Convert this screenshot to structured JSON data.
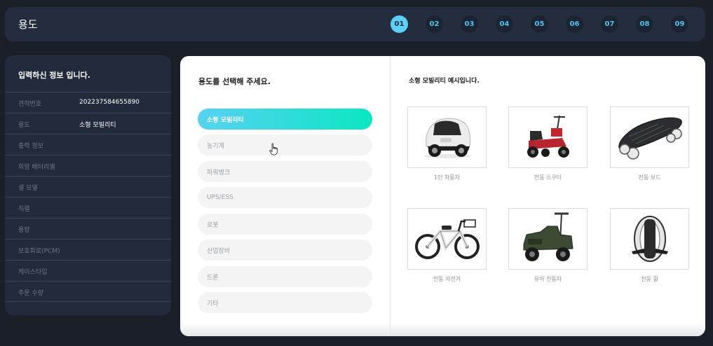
{
  "header": {
    "title": "용도",
    "steps": [
      "01",
      "02",
      "03",
      "04",
      "05",
      "06",
      "07",
      "08",
      "09"
    ],
    "active_step": "01"
  },
  "info": {
    "title": "입력하신 정보 입니다.",
    "rows": [
      {
        "label": "견적번호",
        "value": "202237584655890"
      },
      {
        "label": "용도",
        "value": "소형 모빌리티"
      },
      {
        "label": "출력 정보",
        "value": ""
      },
      {
        "label": "희망 배터리셀",
        "value": ""
      },
      {
        "label": "셀 모델",
        "value": ""
      },
      {
        "label": "직렬",
        "value": ""
      },
      {
        "label": "용량",
        "value": ""
      },
      {
        "label": "보호회로(PCM)",
        "value": ""
      },
      {
        "label": "케이스타입",
        "value": ""
      },
      {
        "label": "주문 수량",
        "value": ""
      }
    ]
  },
  "select": {
    "title": "용도를 선택해 주세요.",
    "options": [
      "소형 모빌리티",
      "농기계",
      "파워뱅크",
      "UPS/ESS",
      "로봇",
      "산업장비",
      "드론",
      "기타"
    ],
    "selected": "소형 모빌리티"
  },
  "examples": {
    "title": "소형 모빌리티 예시입니다.",
    "items": [
      {
        "label": "1인 자동차",
        "icon": "microcar-icon"
      },
      {
        "label": "전동 스쿠터",
        "icon": "electric-scooter-icon"
      },
      {
        "label": "전동 보드",
        "icon": "electric-skateboard-icon"
      },
      {
        "label": "전동 자전거",
        "icon": "electric-bicycle-icon"
      },
      {
        "label": "유아 전동차",
        "icon": "kids-ride-on-car-icon"
      },
      {
        "label": "전동 휠",
        "icon": "electric-unicycle-icon"
      }
    ]
  },
  "colors": {
    "accent": "#5ad2f5",
    "gradient_start": "#58d1f2",
    "gradient_end": "#0ae7c2",
    "panel": "#222b3b"
  }
}
